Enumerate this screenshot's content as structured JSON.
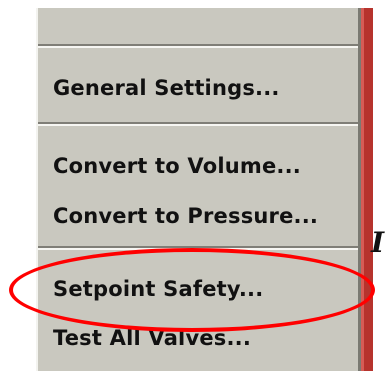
{
  "menu": {
    "items": [
      {
        "label": "General Settings..."
      },
      {
        "label": "Convert to Volume..."
      },
      {
        "label": "Convert to Pressure..."
      },
      {
        "label": "Setpoint Safety..."
      },
      {
        "label": "Test All Valves..."
      }
    ]
  },
  "annotation": {
    "highlight_color": "#ff0000",
    "highlighted_item": "Setpoint Safety..."
  },
  "edge_glyph": "I"
}
